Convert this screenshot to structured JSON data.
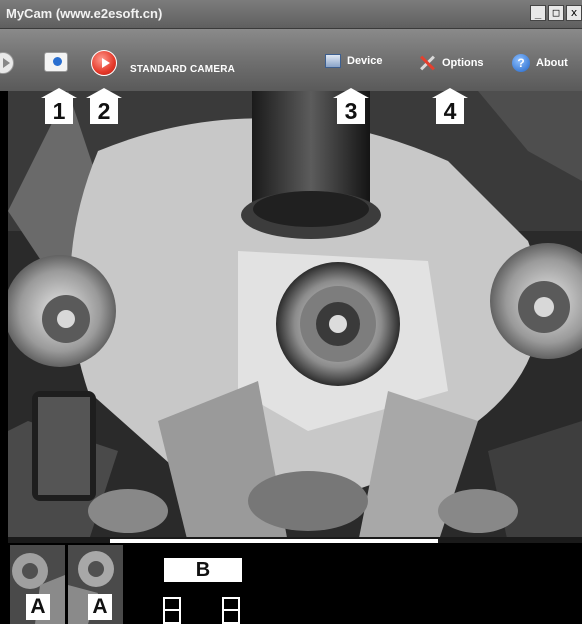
{
  "window": {
    "title": "MyCam (www.e2esoft.cn)",
    "controls": [
      "_",
      "□",
      "x"
    ]
  },
  "toolbar": {
    "camera_name": "STANDARD CAMERA",
    "device_label": "Device",
    "options_label": "Options",
    "about_label": "About",
    "icons": [
      "play-icon",
      "snapshot-icon",
      "record-icon",
      "device-icon",
      "options-icon",
      "about-icon"
    ]
  },
  "callouts": [
    "1",
    "2",
    "3",
    "4"
  ],
  "thumbnails": {
    "labels": [
      "A",
      "A"
    ]
  },
  "panel_b": {
    "label": "B"
  },
  "colors": {
    "toolbar": "#6e6e6e",
    "record": "#e5392a",
    "about": "#1f64c8"
  }
}
